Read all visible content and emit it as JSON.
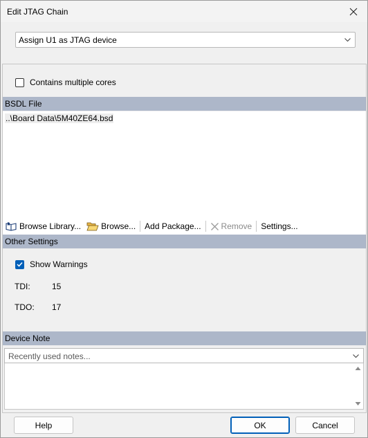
{
  "window": {
    "title": "Edit JTAG Chain"
  },
  "device_select": {
    "value": "Assign U1 as JTAG device"
  },
  "multiple_cores": {
    "label": "Contains multiple cores",
    "checked": false
  },
  "bsdl": {
    "header": "BSDL File",
    "files": [
      "..\\Board Data\\5M40ZE64.bsd"
    ]
  },
  "toolbar": {
    "browse_library": "Browse Library...",
    "browse": "Browse...",
    "add_package": "Add Package...",
    "remove": "Remove",
    "settings": "Settings..."
  },
  "other_settings": {
    "header": "Other Settings",
    "show_warnings_label": "Show Warnings",
    "show_warnings_checked": true,
    "tdi_label": "TDI:",
    "tdi_value": "15",
    "tdo_label": "TDO:",
    "tdo_value": "17"
  },
  "device_note": {
    "header": "Device Note",
    "notes_placeholder": "Recently used notes...",
    "text": ""
  },
  "buttons": {
    "help": "Help",
    "ok": "OK",
    "cancel": "Cancel"
  },
  "colors": {
    "section_header": "#adb7c9",
    "accent": "#005fb8",
    "disabled": "#8a8a8a"
  }
}
